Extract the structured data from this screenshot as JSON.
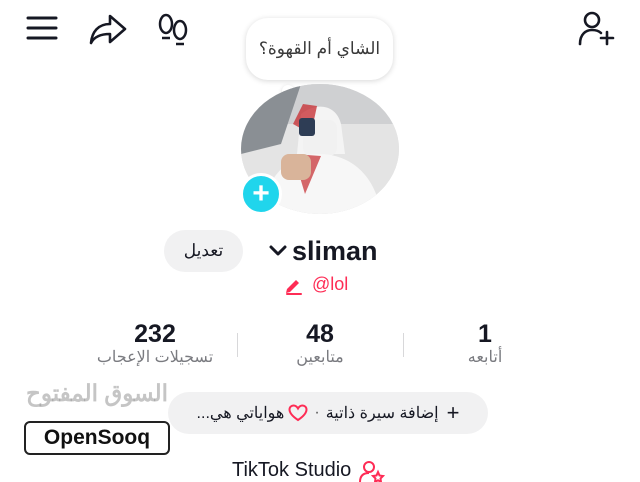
{
  "toolbar": {
    "menu_icon": "menu-icon",
    "share_icon": "share-icon",
    "footprint_icon": "footprint-icon",
    "add_friend_icon": "add-friend-icon"
  },
  "bubble": {
    "text": "الشاي أم القهوة؟"
  },
  "profile": {
    "edit_label": "تعديل",
    "username": "sliman",
    "handle": "@lol",
    "accent": "#fe2c55",
    "avatar_add_color": "#20d5ec"
  },
  "stats": {
    "likes": {
      "value": "232",
      "label": "تسجيلات الإعجاب"
    },
    "followers": {
      "value": "48",
      "label": "متابعين"
    },
    "following": {
      "value": "1",
      "label": "أتابعه"
    }
  },
  "bio": {
    "add_label": "إضافة سيرة ذاتية",
    "separator": "·",
    "hobbies_label": "هواياتي هي..."
  },
  "watermark": {
    "arabic": "السوق المفتوح",
    "brand": "OpenSooq"
  },
  "studio": {
    "label": "TikTok Studio"
  }
}
